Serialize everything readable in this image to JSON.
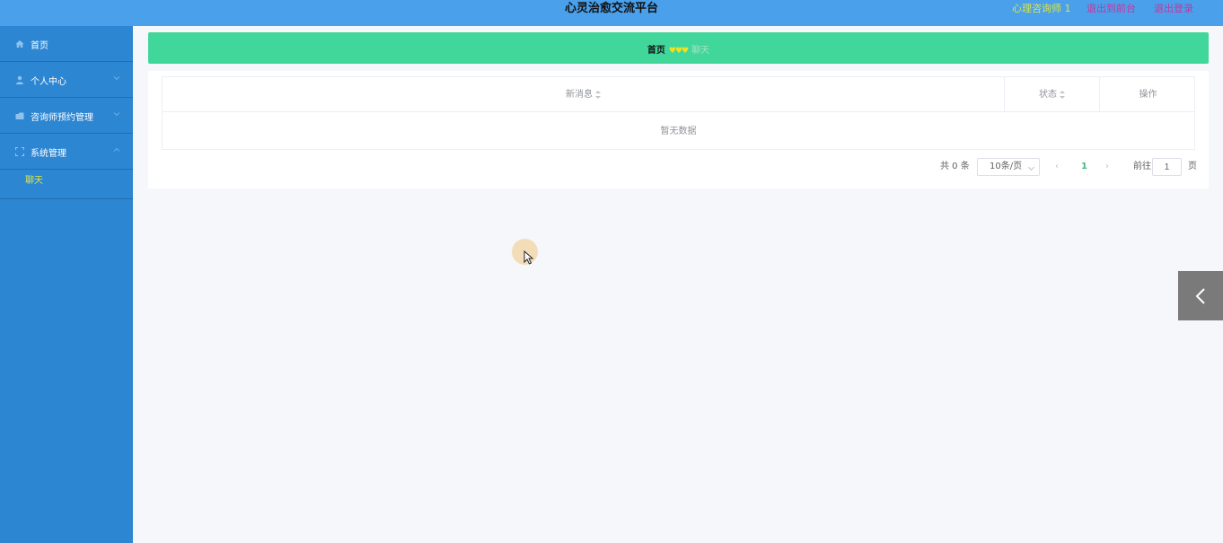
{
  "header": {
    "title": "心灵治愈交流平台",
    "user": "心理咨询师 1",
    "front_link": "退出到前台",
    "logout_link": "退出登录"
  },
  "sidebar": {
    "items": [
      {
        "label": "首页",
        "icon": "home-icon"
      },
      {
        "label": "个人中心",
        "icon": "user-icon"
      },
      {
        "label": "咨询师预约管理",
        "icon": "folder-icon"
      },
      {
        "label": "系统管理",
        "icon": "system-icon"
      }
    ],
    "submenu": {
      "label": "聊天"
    }
  },
  "breadcrumb": {
    "home": "首页",
    "separator": "♥♥♥",
    "current": "聊天"
  },
  "table": {
    "columns": [
      "新消息",
      "状态",
      "操作"
    ],
    "empty_text": "暂无数据"
  },
  "pagination": {
    "total": "共 0 条",
    "page_size": "10条/页",
    "current_page": "1",
    "goto_label": "前往",
    "goto_value": "1",
    "page_unit": "页"
  },
  "colors": {
    "header_bg": "#4aa0ea",
    "sidebar_bg": "#2d86d2",
    "breadcrumb_bg": "#41d79a",
    "accent_yellow": "#d8e54a",
    "link_magenta": "#c7359e"
  }
}
